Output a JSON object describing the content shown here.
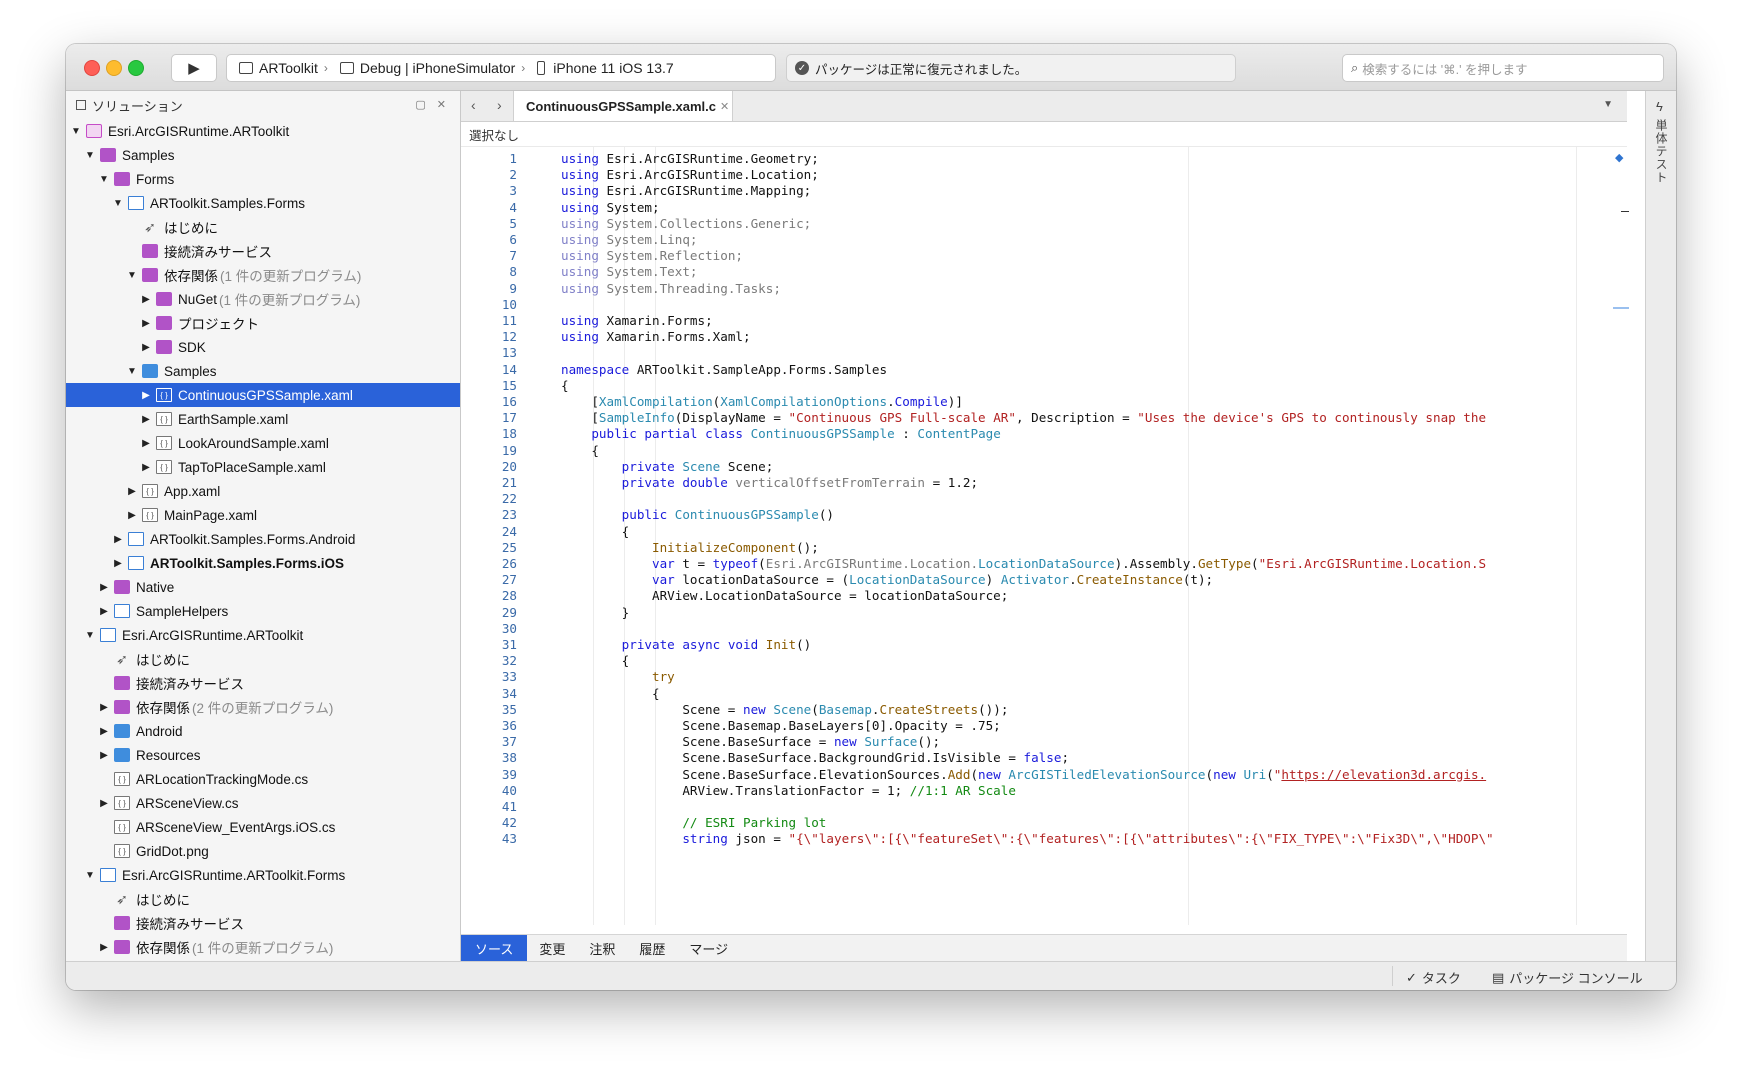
{
  "toolbar": {
    "config": {
      "project": "ARToolkit",
      "configuration": "Debug | iPhoneSimulator",
      "device": "iPhone 11 iOS 13.7"
    },
    "status_message": "パッケージは正常に復元されました。",
    "search_placeholder": "検索するには '⌘.' を押します"
  },
  "sidebar": {
    "title": "ソリューション",
    "tree": [
      {
        "depth": 0,
        "arrow": "▼",
        "icon": "sln",
        "label": "Esri.ArcGISRuntime.ARToolkit",
        "name": "tree-solution"
      },
      {
        "depth": 1,
        "arrow": "▼",
        "icon": "folder-p",
        "label": "Samples",
        "name": "tree-folder"
      },
      {
        "depth": 2,
        "arrow": "▼",
        "icon": "folder-p",
        "label": "Forms",
        "name": "tree-folder"
      },
      {
        "depth": 3,
        "arrow": "▼",
        "icon": "proj",
        "label": "ARToolkit.Samples.Forms",
        "name": "tree-project"
      },
      {
        "depth": 4,
        "arrow": "",
        "icon": "rocket",
        "label": "はじめに",
        "name": "tree-item"
      },
      {
        "depth": 4,
        "arrow": "",
        "icon": "folder-p",
        "label": "接続済みサービス",
        "name": "tree-item"
      },
      {
        "depth": 4,
        "arrow": "▼",
        "icon": "folder-p",
        "label": "依存関係",
        "suffix": "(1 件の更新プログラム)",
        "name": "tree-item"
      },
      {
        "depth": 5,
        "arrow": "▶",
        "icon": "folder-p",
        "label": "NuGet",
        "suffix": "(1 件の更新プログラム)",
        "name": "tree-item"
      },
      {
        "depth": 5,
        "arrow": "▶",
        "icon": "folder-p",
        "label": "プロジェクト",
        "name": "tree-item"
      },
      {
        "depth": 5,
        "arrow": "▶",
        "icon": "folder-p",
        "label": "SDK",
        "name": "tree-item"
      },
      {
        "depth": 4,
        "arrow": "▼",
        "icon": "folder-b",
        "label": "Samples",
        "name": "tree-folder"
      },
      {
        "depth": 5,
        "arrow": "▶",
        "icon": "file",
        "label": "ContinuousGPSSample.xaml",
        "selected": true,
        "name": "tree-file"
      },
      {
        "depth": 5,
        "arrow": "▶",
        "icon": "file",
        "label": "EarthSample.xaml",
        "name": "tree-file"
      },
      {
        "depth": 5,
        "arrow": "▶",
        "icon": "file",
        "label": "LookAroundSample.xaml",
        "name": "tree-file"
      },
      {
        "depth": 5,
        "arrow": "▶",
        "icon": "file",
        "label": "TapToPlaceSample.xaml",
        "name": "tree-file"
      },
      {
        "depth": 4,
        "arrow": "▶",
        "icon": "file",
        "label": "App.xaml",
        "name": "tree-file"
      },
      {
        "depth": 4,
        "arrow": "▶",
        "icon": "file",
        "label": "MainPage.xaml",
        "name": "tree-file"
      },
      {
        "depth": 3,
        "arrow": "▶",
        "icon": "proj",
        "label": "ARToolkit.Samples.Forms.Android",
        "name": "tree-project"
      },
      {
        "depth": 3,
        "arrow": "▶",
        "icon": "proj",
        "label": "ARToolkit.Samples.Forms.iOS",
        "bold": true,
        "name": "tree-project"
      },
      {
        "depth": 2,
        "arrow": "▶",
        "icon": "folder-p",
        "label": "Native",
        "name": "tree-folder"
      },
      {
        "depth": 2,
        "arrow": "▶",
        "icon": "proj",
        "label": "SampleHelpers",
        "name": "tree-project"
      },
      {
        "depth": 1,
        "arrow": "▼",
        "icon": "proj",
        "label": "Esri.ArcGISRuntime.ARToolkit",
        "name": "tree-project"
      },
      {
        "depth": 2,
        "arrow": "",
        "icon": "rocket",
        "label": "はじめに",
        "name": "tree-item"
      },
      {
        "depth": 2,
        "arrow": "",
        "icon": "folder-p",
        "label": "接続済みサービス",
        "name": "tree-item"
      },
      {
        "depth": 2,
        "arrow": "▶",
        "icon": "folder-p",
        "label": "依存関係",
        "suffix": "(2 件の更新プログラム)",
        "name": "tree-item"
      },
      {
        "depth": 2,
        "arrow": "▶",
        "icon": "folder-b",
        "label": "Android",
        "name": "tree-folder"
      },
      {
        "depth": 2,
        "arrow": "▶",
        "icon": "folder-b",
        "label": "Resources",
        "name": "tree-folder"
      },
      {
        "depth": 2,
        "arrow": "",
        "icon": "file",
        "label": "ARLocationTrackingMode.cs",
        "name": "tree-file"
      },
      {
        "depth": 2,
        "arrow": "▶",
        "icon": "file",
        "label": "ARSceneView.cs",
        "name": "tree-file"
      },
      {
        "depth": 2,
        "arrow": "",
        "icon": "file",
        "label": "ARSceneView_EventArgs.iOS.cs",
        "name": "tree-file"
      },
      {
        "depth": 2,
        "arrow": "",
        "icon": "file",
        "label": "GridDot.png",
        "name": "tree-file"
      },
      {
        "depth": 1,
        "arrow": "▼",
        "icon": "proj",
        "label": "Esri.ArcGISRuntime.ARToolkit.Forms",
        "name": "tree-project"
      },
      {
        "depth": 2,
        "arrow": "",
        "icon": "rocket",
        "label": "はじめに",
        "name": "tree-item"
      },
      {
        "depth": 2,
        "arrow": "",
        "icon": "folder-p",
        "label": "接続済みサービス",
        "name": "tree-item"
      },
      {
        "depth": 2,
        "arrow": "▶",
        "icon": "folder-p",
        "label": "依存関係",
        "suffix": "(1 件の更新プログラム)",
        "name": "tree-item"
      }
    ]
  },
  "editor": {
    "tab_label": "ContinuousGPSSample.xaml.c",
    "breadcrumb": "選択なし",
    "lines": [
      [
        [
          "kw",
          "using"
        ],
        [
          "",
          "Esri.ArcGISRuntime.Geometry;"
        ]
      ],
      [
        [
          "kw",
          "using"
        ],
        [
          "",
          "Esri.ArcGISRuntime.Location;"
        ]
      ],
      [
        [
          "kw",
          "using"
        ],
        [
          "",
          "Esri.ArcGISRuntime.Mapping;"
        ]
      ],
      [
        [
          "kw",
          "using"
        ],
        [
          "",
          "System;"
        ]
      ],
      [
        [
          "kwdim",
          "using"
        ],
        [
          "dim",
          "System.Collections.Generic;"
        ]
      ],
      [
        [
          "kwdim",
          "using"
        ],
        [
          "dim",
          "System.Linq;"
        ]
      ],
      [
        [
          "kwdim",
          "using"
        ],
        [
          "dim",
          "System.Reflection;"
        ]
      ],
      [
        [
          "kwdim",
          "using"
        ],
        [
          "dim",
          "System.Text;"
        ]
      ],
      [
        [
          "kwdim",
          "using"
        ],
        [
          "dim",
          "System.Threading.Tasks;"
        ]
      ],
      [],
      [
        [
          "kw",
          "using"
        ],
        [
          "",
          "Xamarin.Forms;"
        ]
      ],
      [
        [
          "kw",
          "using"
        ],
        [
          "",
          "Xamarin.Forms.Xaml;"
        ]
      ],
      [],
      [
        [
          "kw",
          "namespace"
        ],
        [
          "",
          "ARToolkit.SampleApp.Forms.Samples"
        ]
      ],
      [
        [
          "",
          "{"
        ]
      ],
      [
        [
          "",
          "    ["
        ],
        [
          "typ",
          "XamlCompilation"
        ],
        [
          "",
          "("
        ],
        [
          "typ",
          "XamlCompilationOptions"
        ],
        [
          "",
          "."
        ],
        [
          "kw",
          "Compile"
        ],
        [
          "",
          ")]"
        ]
      ],
      [
        [
          "",
          "    ["
        ],
        [
          "typ",
          "SampleInfo"
        ],
        [
          "",
          "(DisplayName = "
        ],
        [
          "str",
          "\"Continuous GPS Full-scale AR\""
        ],
        [
          "",
          ", Description = "
        ],
        [
          "str",
          "\"Uses the device's GPS to continously snap the"
        ]
      ],
      [
        [
          "",
          "    "
        ],
        [
          "kw",
          "public partial class"
        ],
        [
          "",
          " "
        ],
        [
          "typ",
          "ContinuousGPSSample"
        ],
        [
          "",
          " : "
        ],
        [
          "typ",
          "ContentPage"
        ]
      ],
      [
        [
          "",
          "    {"
        ]
      ],
      [
        [
          "",
          "        "
        ],
        [
          "kw",
          "private"
        ],
        [
          "",
          " "
        ],
        [
          "typ",
          "Scene"
        ],
        [
          "",
          " Scene;"
        ]
      ],
      [
        [
          "",
          "        "
        ],
        [
          "kw",
          "private double"
        ],
        [
          "",
          " "
        ],
        [
          "dim",
          "verticalOffsetFromTerrain"
        ],
        [
          "",
          " = 1.2;"
        ]
      ],
      [],
      [
        [
          "",
          "        "
        ],
        [
          "kw",
          "public"
        ],
        [
          "",
          " "
        ],
        [
          "typ",
          "ContinuousGPSSample"
        ],
        [
          "",
          "()"
        ]
      ],
      [
        [
          "",
          "        {"
        ]
      ],
      [
        [
          "",
          "            "
        ],
        [
          "mth",
          "InitializeComponent"
        ],
        [
          "",
          "();"
        ]
      ],
      [
        [
          "",
          "            "
        ],
        [
          "kw",
          "var"
        ],
        [
          "",
          " t = "
        ],
        [
          "kw",
          "typeof"
        ],
        [
          "",
          "("
        ],
        [
          "dim",
          "Esri.ArcGISRuntime.Location."
        ],
        [
          "typ",
          "LocationDataSource"
        ],
        [
          "",
          ").Assembly."
        ],
        [
          "mth",
          "GetType"
        ],
        [
          "",
          "("
        ],
        [
          "str",
          "\"Esri.ArcGISRuntime.Location.S"
        ]
      ],
      [
        [
          "",
          "            "
        ],
        [
          "kw",
          "var"
        ],
        [
          "",
          " locationDataSource = ("
        ],
        [
          "typ",
          "LocationDataSource"
        ],
        [
          "",
          ")"
        ],
        [
          "typ",
          "Activator"
        ],
        [
          "",
          "."
        ],
        [
          "mth",
          "CreateInstance"
        ],
        [
          "",
          "(t);"
        ]
      ],
      [
        [
          "",
          "            ARView.LocationDataSource = locationDataSource;"
        ]
      ],
      [
        [
          "",
          "        }"
        ]
      ],
      [],
      [
        [
          "",
          "        "
        ],
        [
          "kw",
          "private async void"
        ],
        [
          "",
          " "
        ],
        [
          "mth",
          "Init"
        ],
        [
          "",
          "()"
        ]
      ],
      [
        [
          "",
          "        {"
        ]
      ],
      [
        [
          "",
          "            "
        ],
        [
          "mth",
          "try"
        ]
      ],
      [
        [
          "",
          "            {"
        ]
      ],
      [
        [
          "",
          "                Scene = "
        ],
        [
          "kw",
          "new"
        ],
        [
          "",
          " "
        ],
        [
          "typ",
          "Scene"
        ],
        [
          "",
          "("
        ],
        [
          "typ",
          "Basemap"
        ],
        [
          "",
          "."
        ],
        [
          "mth",
          "CreateStreets"
        ],
        [
          "",
          "());"
        ]
      ],
      [
        [
          "",
          "                Scene.Basemap.BaseLayers[0].Opacity = .75;"
        ]
      ],
      [
        [
          "",
          "                Scene.BaseSurface = "
        ],
        [
          "kw",
          "new"
        ],
        [
          "",
          " "
        ],
        [
          "typ",
          "Surface"
        ],
        [
          "",
          "();"
        ]
      ],
      [
        [
          "",
          "                Scene.BaseSurface.BackgroundGrid.IsVisible = "
        ],
        [
          "kw",
          "false"
        ],
        [
          "",
          ";"
        ]
      ],
      [
        [
          "",
          "                Scene.BaseSurface.ElevationSources."
        ],
        [
          "mth",
          "Add"
        ],
        [
          "",
          "("
        ],
        [
          "kw",
          "new"
        ],
        [
          "",
          " "
        ],
        [
          "typ",
          "ArcGISTiledElevationSource"
        ],
        [
          "",
          "("
        ],
        [
          "kw",
          "new"
        ],
        [
          "",
          " "
        ],
        [
          "typ",
          "Uri"
        ],
        [
          "",
          "("
        ],
        [
          "str",
          "\""
        ],
        [
          "url",
          "https://elevation3d.arcgis."
        ]
      ],
      [
        [
          "",
          "                ARView.TranslationFactor = 1; "
        ],
        [
          "cmt",
          "//1:1 AR Scale"
        ]
      ],
      [],
      [
        [
          "",
          "                "
        ],
        [
          "cmt",
          "// ESRI Parking lot"
        ]
      ],
      [
        [
          "",
          "                "
        ],
        [
          "kw",
          "string"
        ],
        [
          "",
          " json = "
        ],
        [
          "str",
          "\"{\\\"layers\\\":[{\\\"featureSet\\\":{\\\"features\\\":[{\\\"attributes\\\":{\\\"FIX_TYPE\\\":\\\"Fix3D\\\",\\\"HDOP\\\""
        ]
      ]
    ]
  },
  "bottom_tabs": [
    "ソース",
    "変更",
    "注釈",
    "履歴",
    "マージ"
  ],
  "right_rail_label": "単体テスト",
  "footer": {
    "tasks_label": "タスク",
    "package_console_label": "パッケージ コンソール"
  },
  "colors": {
    "selection": "#2a62d9",
    "keyword": "#1a1adb",
    "type": "#2a8aaf",
    "string": "#b22222",
    "comment": "#138a13",
    "line_number": "#3a6aa8"
  }
}
